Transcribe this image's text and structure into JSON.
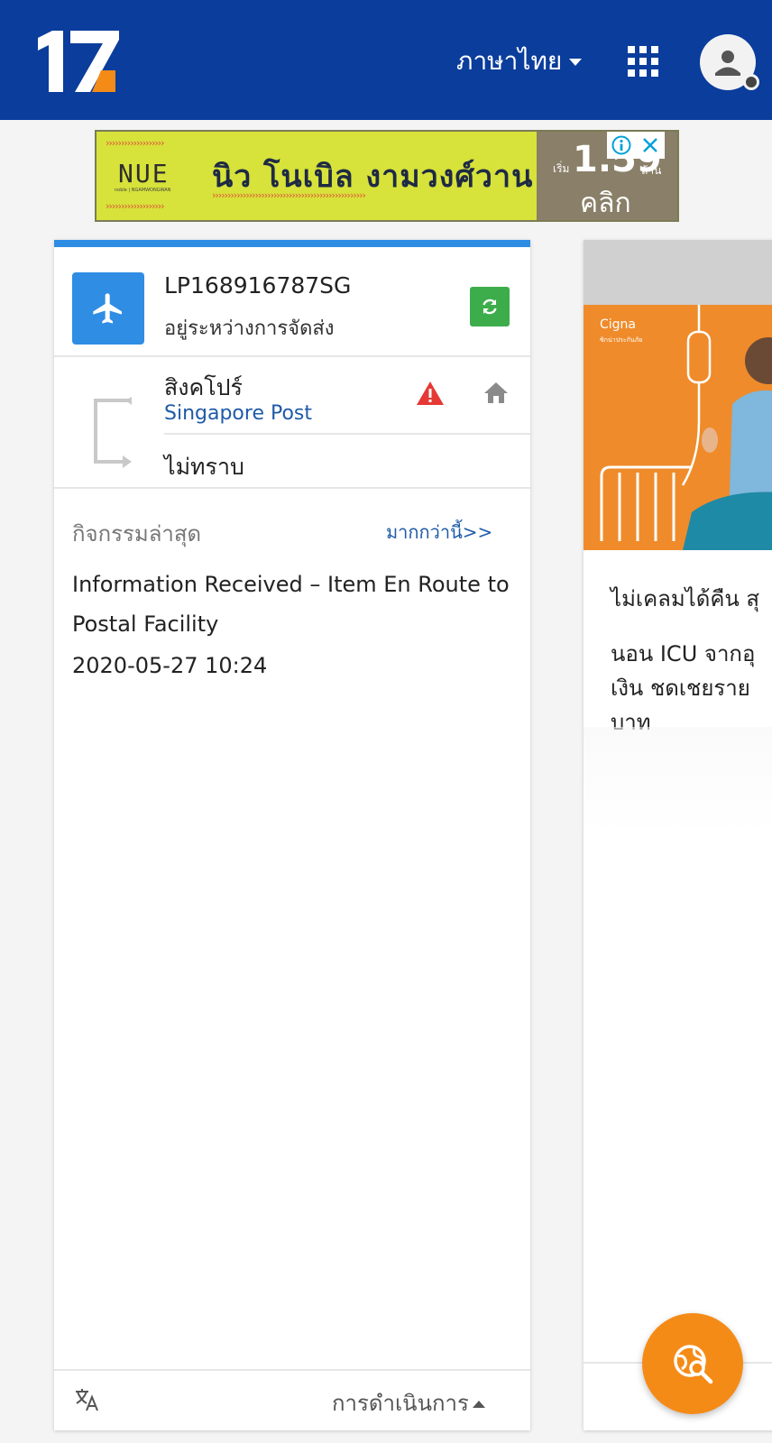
{
  "header": {
    "logo_text": "17",
    "language_label": "ภาษาไทย"
  },
  "ad_banner": {
    "brand": "NUE",
    "brand_sub": "noble | NGAMWONGWAN",
    "title": "นิว โนเบิล งามวงศ์วาน",
    "price_prefix": "เริ่ม",
    "price_value": "1.59",
    "price_unit": "ล้าน",
    "cta": "คลิก"
  },
  "shipment": {
    "tracking_number": "LP168916787SG",
    "status": "อยู่ระหว่างการจัดส่ง",
    "origin_country": "สิงคโปร์",
    "carrier": "Singapore Post",
    "destination_status": "ไม่ทราบ",
    "latest_label": "กิจกรรมล่าสุด",
    "more_link": "มากกว่านี้>>",
    "latest_event": "Information Received – Item En Route to Postal Facility",
    "latest_time": "2020-05-27 10:24",
    "actions_label": "การดำเนินการ"
  },
  "side_ad": {
    "brand": "Cigna",
    "brand_sub": "ซิกน่าประกันภัย",
    "headline": "ไม่เคลมได้คืน สุ",
    "body": "นอน ICU จากอุ\nเงิน ชดเชยราย\nบาท"
  },
  "colors": {
    "header_bg": "#0a3d9c",
    "card_accent": "#2d8de3",
    "refresh_green": "#3cad4a",
    "warning_red": "#e53935",
    "fab_orange": "#f58b17",
    "link_blue": "#1f5ba8"
  },
  "icons": {
    "logo": "seventeen-track-logo",
    "apps": "grid-apps-icon",
    "avatar": "user-avatar-icon",
    "plane": "airplane-icon",
    "refresh": "refresh-icon",
    "warning": "warning-triangle-icon",
    "home": "home-icon",
    "translate": "translate-icon",
    "fab": "track-search-icon"
  }
}
